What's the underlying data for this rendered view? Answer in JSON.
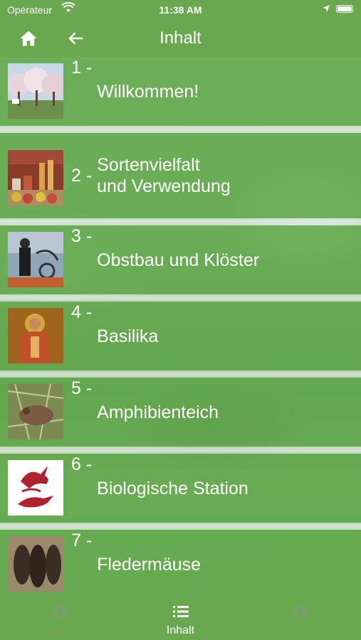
{
  "status": {
    "carrier": "Opérateur",
    "time": "11:38 AM"
  },
  "navbar": {
    "title": "Inhalt",
    "home_icon": "home-icon",
    "back_icon": "arrow-left-icon"
  },
  "items": [
    {
      "number": "1 -",
      "title": "Willkommen!"
    },
    {
      "number": "2 -",
      "title": "Sortenvielfalt\nund Verwendung"
    },
    {
      "number": "3 -",
      "title": "Obstbau und Klöster"
    },
    {
      "number": "4 -",
      "title": "Basilika"
    },
    {
      "number": "5 -",
      "title": "Amphibienteich"
    },
    {
      "number": "6 -",
      "title": "Biologische Station"
    },
    {
      "number": "7 -",
      "title": "Fledermäuse"
    }
  ],
  "tabs": [
    {
      "label": "Karte",
      "icon": "compass-icon",
      "active": false
    },
    {
      "label": "Inhalt",
      "icon": "list-icon",
      "active": true
    },
    {
      "label": "Impressum",
      "icon": "info-icon",
      "active": false
    }
  ],
  "colors": {
    "primary_green": "#6aa84f",
    "row_overlay": "#64aa50"
  }
}
